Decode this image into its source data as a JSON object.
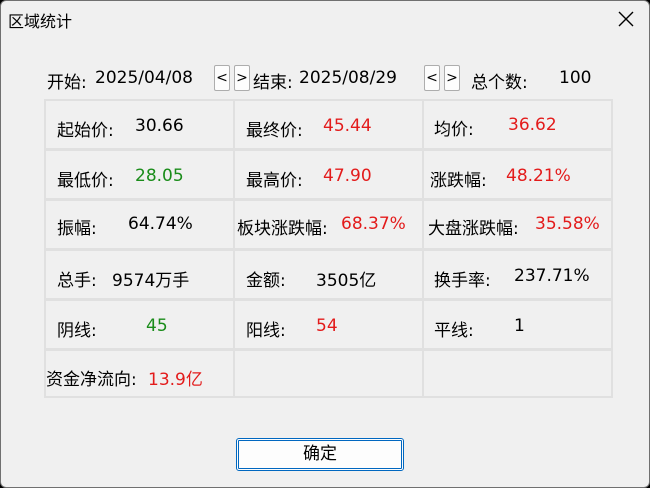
{
  "window": {
    "title": "区域统计",
    "ok_label": "确定"
  },
  "range": {
    "start_label": "开始:",
    "start_date": "2025/04/08",
    "end_label": "结束:",
    "end_date": "2025/08/29",
    "prev_label": "<",
    "next_label": ">",
    "count_label": "总个数:",
    "count_value": "100"
  },
  "stats": {
    "open_price": {
      "label": "起始价:",
      "value": "30.66"
    },
    "close_price": {
      "label": "最终价:",
      "value": "45.44"
    },
    "avg_price": {
      "label": "均价:",
      "value": "36.62"
    },
    "low_price": {
      "label": "最低价:",
      "value": "28.05"
    },
    "high_price": {
      "label": "最高价:",
      "value": "47.90"
    },
    "change_pct": {
      "label": "涨跌幅:",
      "value": "48.21%"
    },
    "amplitude": {
      "label": "振幅:",
      "value": "64.74%"
    },
    "sector_change": {
      "label": "板块涨跌幅:",
      "value": "68.37%"
    },
    "market_change": {
      "label": "大盘涨跌幅:",
      "value": "35.58%"
    },
    "volume": {
      "label": "总手:",
      "value": "9574万手"
    },
    "amount": {
      "label": "金额:",
      "value": "3505亿"
    },
    "turnover": {
      "label": "换手率:",
      "value": "237.71%"
    },
    "down_days": {
      "label": "阴线:",
      "value": "45"
    },
    "up_days": {
      "label": "阳线:",
      "value": "54"
    },
    "flat_days": {
      "label": "平线:",
      "value": "1"
    },
    "net_inflow": {
      "label": "资金净流向:",
      "value": "13.9亿"
    }
  },
  "colors": {
    "up": "#e31b1b",
    "down": "#1a8c1a",
    "neutral": "#000000"
  },
  "icons": {
    "close": "close-icon"
  }
}
